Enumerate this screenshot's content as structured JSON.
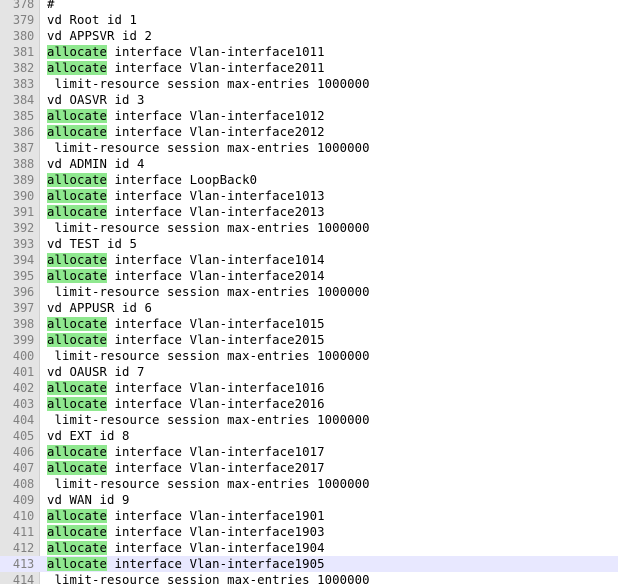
{
  "editor": {
    "keyword_highlight_color": "#8fe88f",
    "current_line_color": "#e8e8ff",
    "current_line_number": "413",
    "lines": [
      {
        "num": "378",
        "kw": "",
        "text": "#"
      },
      {
        "num": "379",
        "kw": "",
        "text": "vd Root id 1"
      },
      {
        "num": "380",
        "kw": "",
        "text": "vd APPSVR id 2"
      },
      {
        "num": "381",
        "kw": "allocate",
        "text": " interface Vlan-interface1011"
      },
      {
        "num": "382",
        "kw": "allocate",
        "text": " interface Vlan-interface2011"
      },
      {
        "num": "383",
        "kw": "",
        "text": " limit-resource session max-entries 1000000"
      },
      {
        "num": "384",
        "kw": "",
        "text": "vd OASVR id 3"
      },
      {
        "num": "385",
        "kw": "allocate",
        "text": " interface Vlan-interface1012"
      },
      {
        "num": "386",
        "kw": "allocate",
        "text": " interface Vlan-interface2012"
      },
      {
        "num": "387",
        "kw": "",
        "text": " limit-resource session max-entries 1000000"
      },
      {
        "num": "388",
        "kw": "",
        "text": "vd ADMIN id 4"
      },
      {
        "num": "389",
        "kw": "allocate",
        "text": " interface LoopBack0"
      },
      {
        "num": "390",
        "kw": "allocate",
        "text": " interface Vlan-interface1013"
      },
      {
        "num": "391",
        "kw": "allocate",
        "text": " interface Vlan-interface2013"
      },
      {
        "num": "392",
        "kw": "",
        "text": " limit-resource session max-entries 1000000"
      },
      {
        "num": "393",
        "kw": "",
        "text": "vd TEST id 5"
      },
      {
        "num": "394",
        "kw": "allocate",
        "text": " interface Vlan-interface1014"
      },
      {
        "num": "395",
        "kw": "allocate",
        "text": " interface Vlan-interface2014"
      },
      {
        "num": "396",
        "kw": "",
        "text": " limit-resource session max-entries 1000000"
      },
      {
        "num": "397",
        "kw": "",
        "text": "vd APPUSR id 6"
      },
      {
        "num": "398",
        "kw": "allocate",
        "text": " interface Vlan-interface1015"
      },
      {
        "num": "399",
        "kw": "allocate",
        "text": " interface Vlan-interface2015"
      },
      {
        "num": "400",
        "kw": "",
        "text": " limit-resource session max-entries 1000000"
      },
      {
        "num": "401",
        "kw": "",
        "text": "vd OAUSR id 7"
      },
      {
        "num": "402",
        "kw": "allocate",
        "text": " interface Vlan-interface1016"
      },
      {
        "num": "403",
        "kw": "allocate",
        "text": " interface Vlan-interface2016"
      },
      {
        "num": "404",
        "kw": "",
        "text": " limit-resource session max-entries 1000000"
      },
      {
        "num": "405",
        "kw": "",
        "text": "vd EXT id 8"
      },
      {
        "num": "406",
        "kw": "allocate",
        "text": " interface Vlan-interface1017"
      },
      {
        "num": "407",
        "kw": "allocate",
        "text": " interface Vlan-interface2017"
      },
      {
        "num": "408",
        "kw": "",
        "text": " limit-resource session max-entries 1000000"
      },
      {
        "num": "409",
        "kw": "",
        "text": "vd WAN id 9"
      },
      {
        "num": "410",
        "kw": "allocate",
        "text": " interface Vlan-interface1901"
      },
      {
        "num": "411",
        "kw": "allocate",
        "text": " interface Vlan-interface1903"
      },
      {
        "num": "412",
        "kw": "allocate",
        "text": " interface Vlan-interface1904"
      },
      {
        "num": "413",
        "kw": "allocate",
        "text": " interface Vlan-interface1905"
      },
      {
        "num": "414",
        "kw": "",
        "text": " limit-resource session max-entries 1000000"
      }
    ]
  }
}
